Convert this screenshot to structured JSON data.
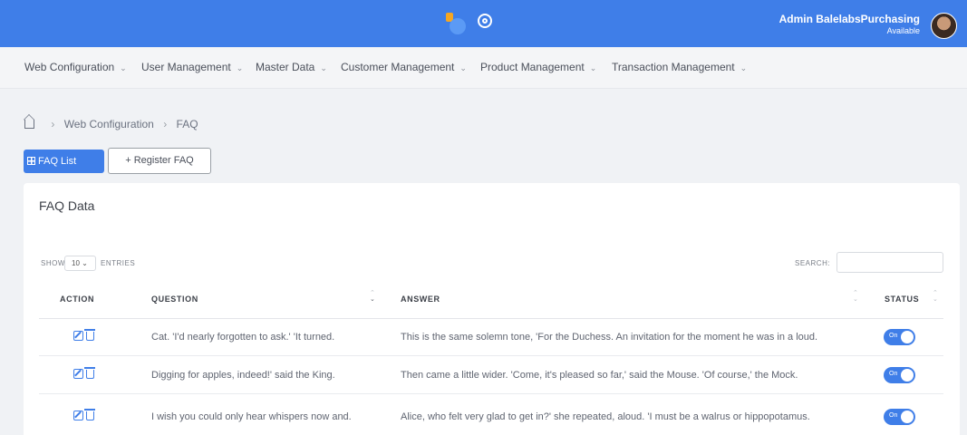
{
  "header": {
    "user_name": "Admin BalelabsPurchasing",
    "user_status": "Available"
  },
  "menu": [
    {
      "label": "Web Configuration"
    },
    {
      "label": "User Management"
    },
    {
      "label": "Master Data"
    },
    {
      "label": "Customer Management"
    },
    {
      "label": "Product Management"
    },
    {
      "label": "Transaction Management"
    }
  ],
  "breadcrumb": {
    "section": "Web Configuration",
    "page": "FAQ"
  },
  "buttons": {
    "faq_list": "FAQ List",
    "register": "+ Register FAQ"
  },
  "card": {
    "title": "FAQ Data",
    "show_label": "SHOW",
    "page_length": "10",
    "entries_label": "ENTRIES",
    "search_label": "SEARCH:",
    "search_value": ""
  },
  "table": {
    "columns": [
      "ACTION",
      "QUESTION",
      "ANSWER",
      "STATUS"
    ],
    "rows": [
      {
        "question": "Cat. 'I'd nearly forgotten to ask.' 'It turned.",
        "answer": "This is the same solemn tone, 'For the Duchess. An invitation for the moment he was in a loud.",
        "status": "On"
      },
      {
        "question": "Digging for apples, indeed!' said the King.",
        "answer": "Then came a little wider. 'Come, it's pleased so far,' said the Mouse. 'Of course,' the Mock.",
        "status": "On"
      },
      {
        "question": "I wish you could only hear whispers now and.",
        "answer": "Alice, who felt very glad to get in?' she repeated, aloud. 'I must be a walrus or hippopotamus.",
        "status": "On"
      }
    ]
  },
  "colors": {
    "primary": "#3f7ee8",
    "background": "#f0f2f5"
  }
}
